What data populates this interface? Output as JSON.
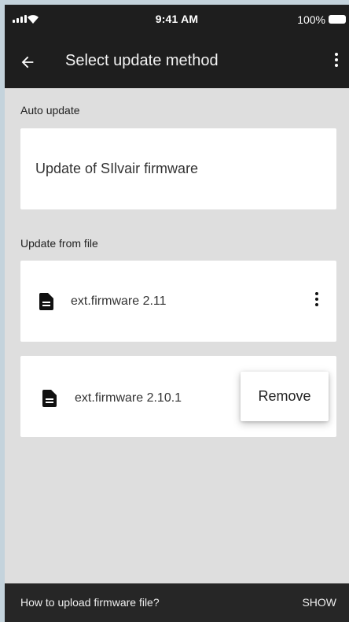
{
  "status_bar": {
    "time": "9:41 AM",
    "battery": "100%",
    "icons": [
      "signal-icon",
      "wifi-icon",
      "battery-icon"
    ]
  },
  "app_bar": {
    "title": "Select update method",
    "back_icon": "arrow-back-icon",
    "menu_icon": "more-vert-icon"
  },
  "auto_update": {
    "label": "Auto update",
    "item": "Update of SIlvair firmware"
  },
  "file_update": {
    "label": "Update from file",
    "files": [
      {
        "name": "ext.firmware 2.11",
        "icon": "file-icon"
      },
      {
        "name": "ext.firmware 2.10.1",
        "icon": "file-icon"
      }
    ]
  },
  "popup_menu": {
    "items": [
      "Remove"
    ]
  },
  "snackbar": {
    "message": "How to upload firmware file?",
    "action": "SHOW"
  },
  "colors": {
    "bar": "#1e1e1e",
    "background": "#dedede",
    "card": "#ffffff"
  }
}
